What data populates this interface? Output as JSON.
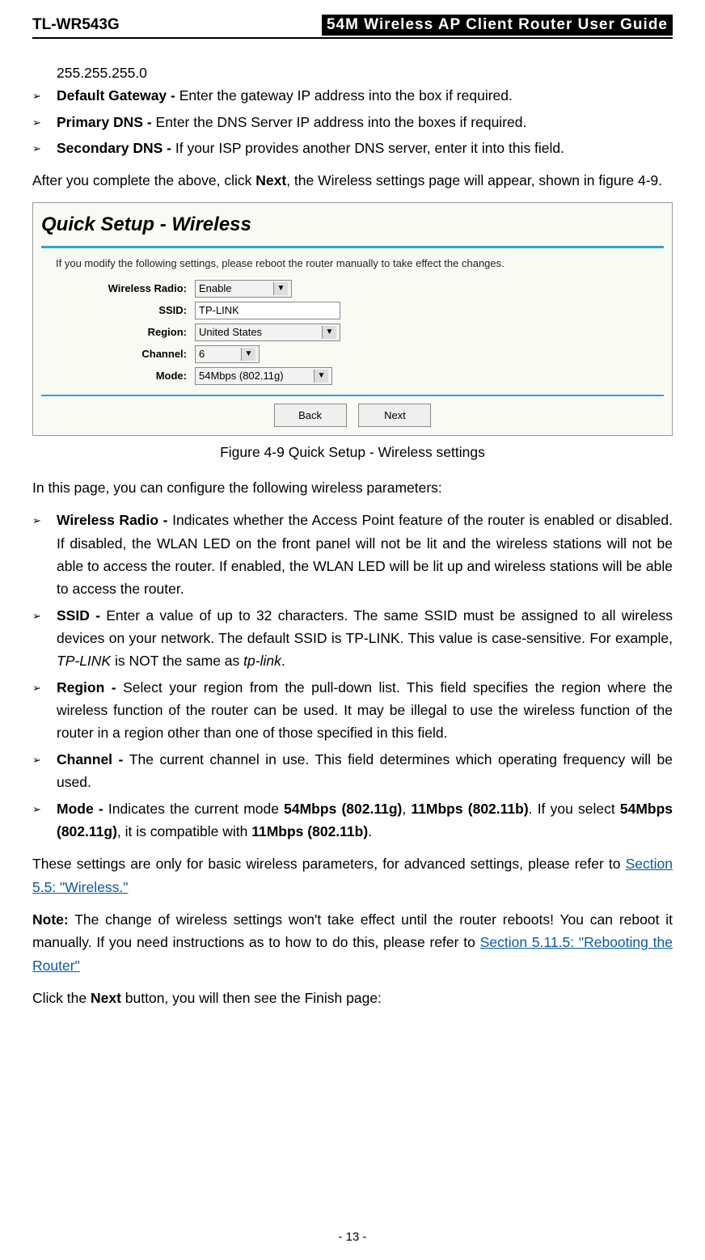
{
  "header": {
    "model": "TL-WR543G",
    "title": "54M Wireless AP Client Router User Guide"
  },
  "cont_line": "255.255.255.0",
  "top_bullets": [
    {
      "label": "Default Gateway - ",
      "text": "Enter the gateway IP address into the box if required."
    },
    {
      "label": "Primary DNS - ",
      "text": "Enter the DNS Server IP address into the boxes if required."
    },
    {
      "label": "Secondary DNS - ",
      "text": "If your ISP provides another DNS server, enter it into this field."
    }
  ],
  "after_top_1": "After you complete the above, click ",
  "after_top_bold": "Next",
  "after_top_2": ", the Wireless settings page will appear, shown in figure 4-9.",
  "figure": {
    "title": "Quick Setup - Wireless",
    "note": "If you modify the following settings, please reboot the router manually to take effect the changes.",
    "rows": {
      "wireless_radio": {
        "label": "Wireless Radio:",
        "value": "Enable"
      },
      "ssid": {
        "label": "SSID:",
        "value": "TP-LINK"
      },
      "region": {
        "label": "Region:",
        "value": "United States"
      },
      "channel": {
        "label": "Channel:",
        "value": "6"
      },
      "mode": {
        "label": "Mode:",
        "value": "54Mbps (802.11g)"
      }
    },
    "buttons": {
      "back": "Back",
      "next": "Next"
    },
    "caption": "Figure 4-9    Quick Setup - Wireless settings"
  },
  "intro2": "In this page, you can configure the following wireless parameters:",
  "param_bullets": [
    {
      "label": "Wireless Radio - ",
      "text": "Indicates whether the Access Point feature of the router is enabled or disabled. If disabled, the WLAN LED on the front panel will not be lit and the wireless stations will not be able to access the router. If enabled, the WLAN LED will be lit up and wireless stations will be able to access the router."
    },
    {
      "label": "SSID - ",
      "text_pre": "Enter a value of up to 32 characters. The same SSID must be assigned to all wireless devices on your network. The default SSID is TP-LINK. This value is case-sensitive. For example, ",
      "it1": "TP-LINK",
      "mid": " is NOT the same as ",
      "it2": "tp-link",
      "post": "."
    },
    {
      "label": "Region - ",
      "text": "Select your region from the pull-down list. This field specifies the region where the wireless function of the router can be used. It may be illegal to use the wireless function of the router in a region other than one of those specified in this field."
    },
    {
      "label": "Channel - ",
      "text": "The current channel in use. This field determines which operating frequency will be used."
    },
    {
      "label": "Mode - ",
      "pre": "Indicates the current mode ",
      "b1": "54Mbps (802.11g)",
      "mid1": ", ",
      "b2": "11Mbps (802.11b)",
      "mid2": ". If you select ",
      "b3": "54Mbps (802.11g)",
      "mid3": ", it is compatible with ",
      "b4": "11Mbps (802.11b)",
      "post": "."
    }
  ],
  "advanced_pre": "These settings are only for basic wireless parameters, for advanced settings, please refer to ",
  "advanced_link": "Section 5.5: \"Wireless.\"",
  "note_label": "Note:",
  "note_text1": " The change of wireless settings won't take effect until the router reboots! You can reboot it manually. If you need instructions as to how to do this, please refer to ",
  "note_link": "Section 5.11.5: \"Rebooting the Router\"",
  "click_next_pre": "Click the ",
  "click_next_bold": "Next",
  "click_next_post": " button, you will then see the Finish page:",
  "page_number": "- 13 -"
}
